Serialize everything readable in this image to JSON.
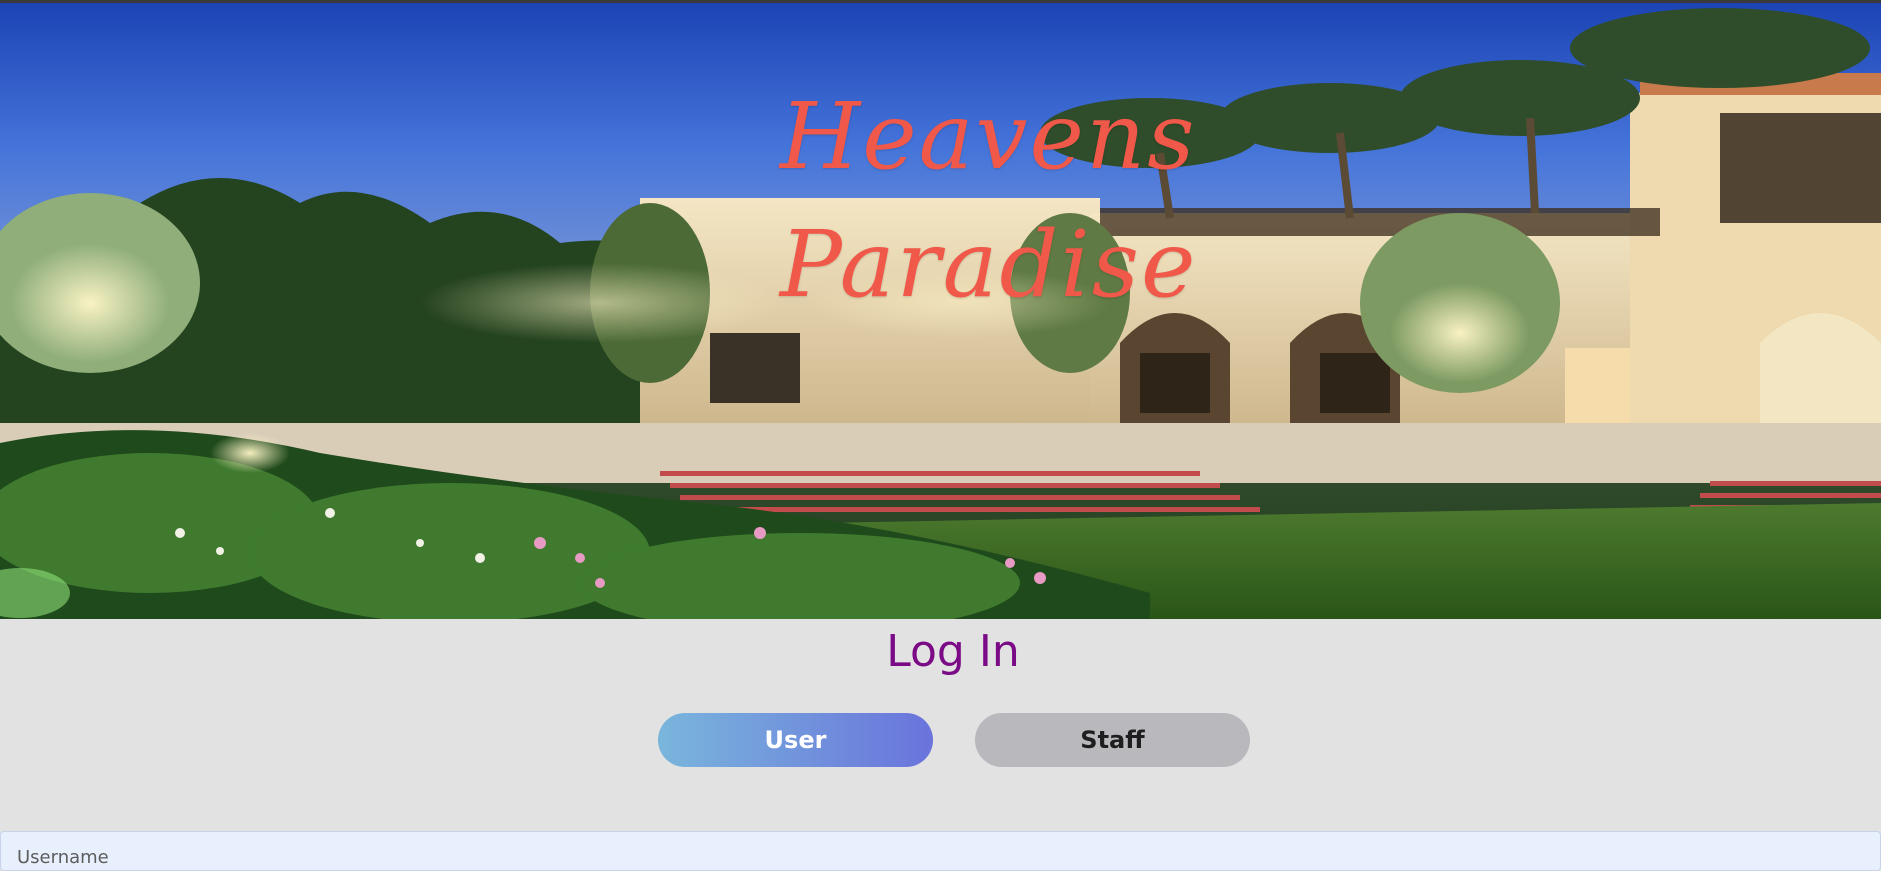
{
  "hero": {
    "brand_line1": "Heavens",
    "brand_line2": "Paradise",
    "image": "resort-at-night-photo"
  },
  "login": {
    "title": "Log In",
    "tabs": [
      {
        "label": "User",
        "active": true
      },
      {
        "label": "Staff",
        "active": false
      }
    ],
    "username_placeholder": "Username"
  },
  "colors": {
    "brand": "#f0584a",
    "title": "#7a0a86",
    "user_tab_start": "#79b6dc",
    "user_tab_end": "#6a73dc",
    "staff_tab": "#b8b8bd",
    "page_bg": "#e2e2e2"
  }
}
